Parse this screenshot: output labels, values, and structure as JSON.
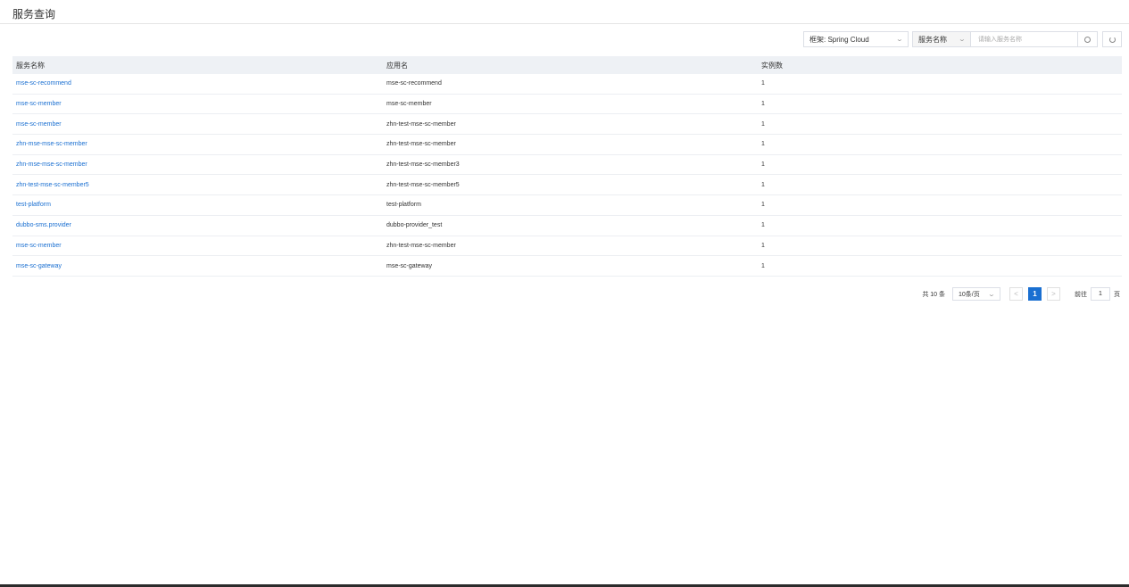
{
  "page": {
    "title": "服务查询"
  },
  "toolbar": {
    "framework_select": "框架: Spring Cloud",
    "field_select": "服务名称",
    "search_placeholder": "请输入服务名称"
  },
  "table": {
    "headers": [
      "服务名称",
      "应用名",
      "实例数"
    ],
    "rows": [
      {
        "service": "mse-sc-recommend",
        "app": "mse-sc-recommend",
        "instances": "1"
      },
      {
        "service": "mse-sc-member",
        "app": "mse-sc-member",
        "instances": "1"
      },
      {
        "service": "mse-sc-member",
        "app": "zhn-test-mse-sc-member",
        "instances": "1"
      },
      {
        "service": "zhn-mse-mse-sc-member",
        "app": "zhn-test-mse-sc-member",
        "instances": "1"
      },
      {
        "service": "zhn-mse-mse-sc-member",
        "app": "zhn-test-mse-sc-member3",
        "instances": "1"
      },
      {
        "service": "zhn-test-mse-sc-member5",
        "app": "zhn-test-mse-sc-member5",
        "instances": "1"
      },
      {
        "service": "test-platform",
        "app": "test-platform",
        "instances": "1"
      },
      {
        "service": "dubbo-sms.provider",
        "app": "dubbo-provider_test",
        "instances": "1"
      },
      {
        "service": "mse-sc-member",
        "app": "zhn-test-mse-sc-member",
        "instances": "1"
      },
      {
        "service": "mse-sc-gateway",
        "app": "mse-sc-gateway",
        "instances": "1"
      }
    ]
  },
  "pagination": {
    "total": "共 10 条",
    "page_size": "10条/页",
    "prev": "<",
    "current": "1",
    "next": ">",
    "goto_label": "前往",
    "goto_value": "1",
    "goto_suffix": "页"
  }
}
